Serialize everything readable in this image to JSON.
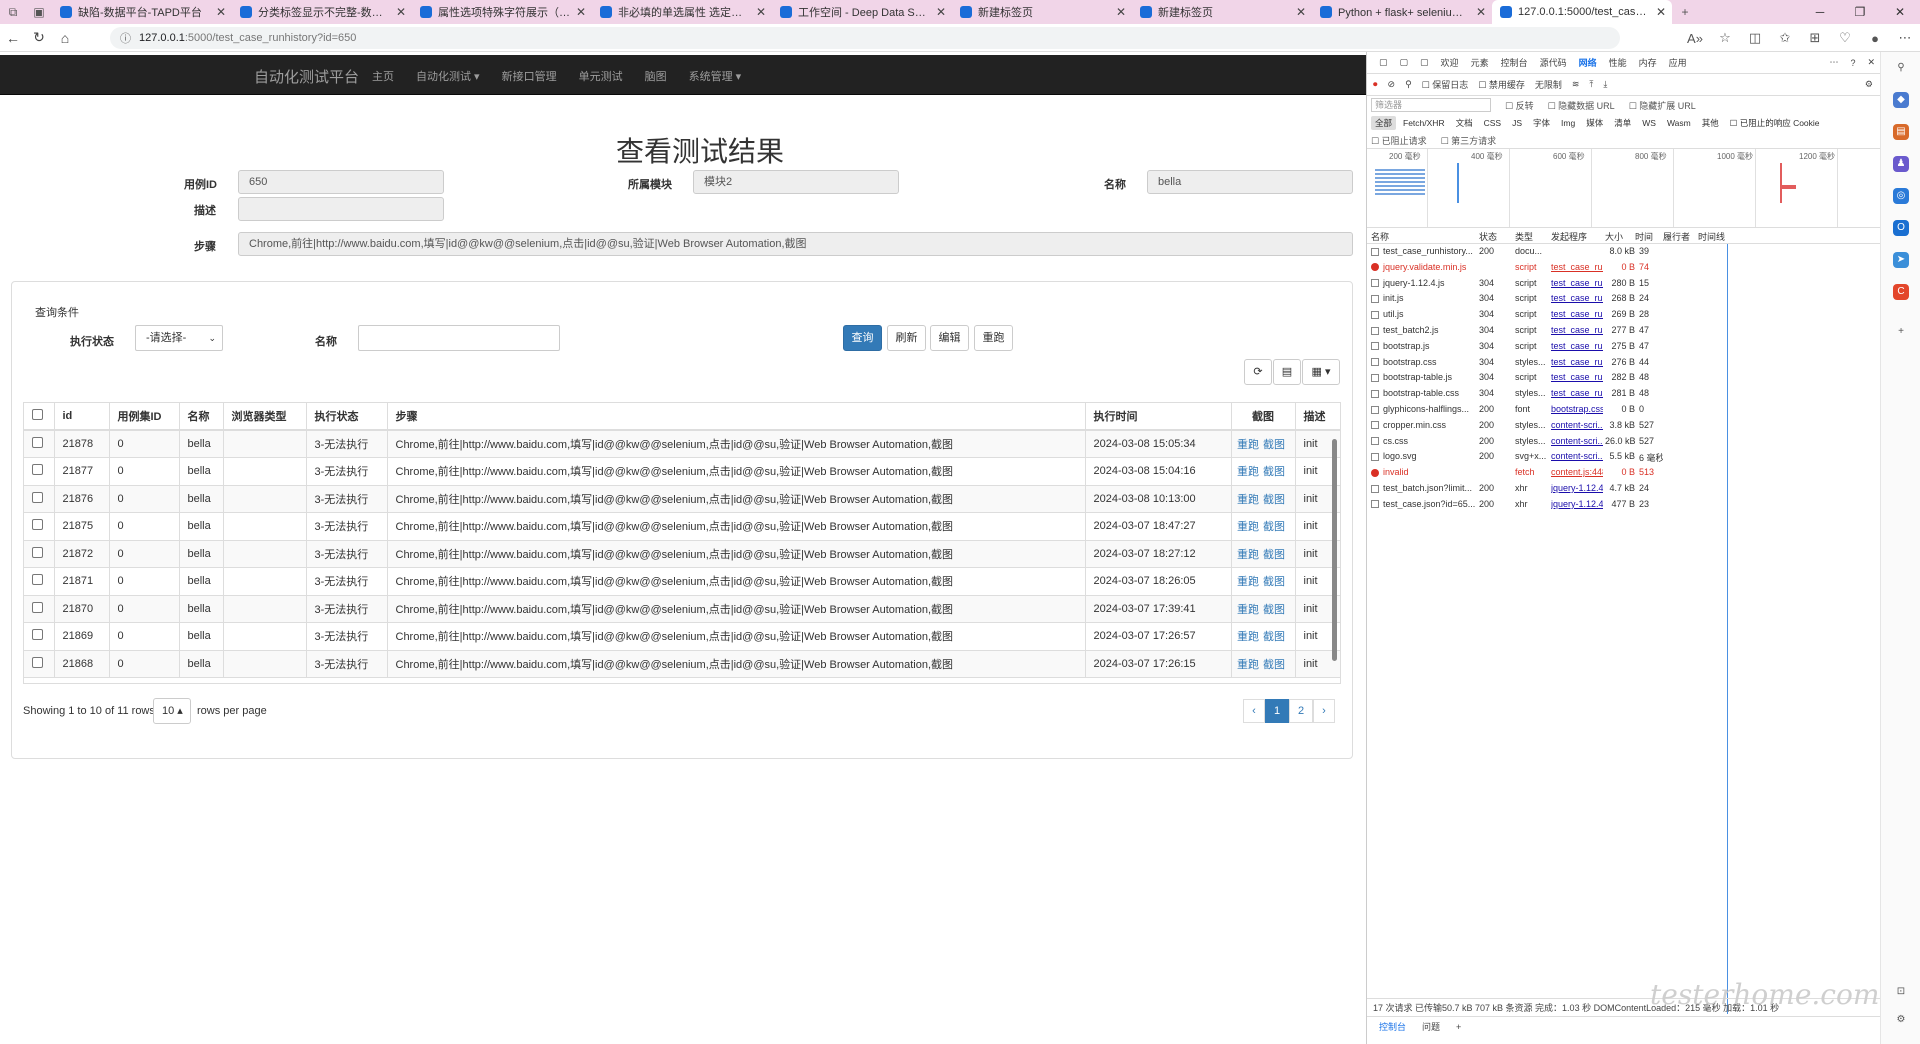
{
  "browser": {
    "tabs": [
      {
        "title": "缺陷-数据平台-TAPD平台"
      },
      {
        "title": "分类标签显示不完整-数据平台-T"
      },
      {
        "title": "属性选项特殊字符展示（空格、"
      },
      {
        "title": "非必填的单选属性 选定默认值后"
      },
      {
        "title": "工作空间 - Deep Data Space"
      },
      {
        "title": "新建标签页"
      },
      {
        "title": "新建标签页"
      },
      {
        "title": "Python + flask+ selenium 自动化"
      },
      {
        "title": "127.0.0.1:5000/test_case_runhist"
      }
    ],
    "url_host": "127.0.0.1",
    "url_path": ":5000/test_case_runhistory?id=650"
  },
  "navbar": {
    "brand": "自动化测试平台",
    "links": [
      "主页",
      "自动化测试 ▾",
      "新接口管理",
      "单元测试",
      "脑图",
      "系统管理 ▾"
    ]
  },
  "page": {
    "title": "查看测试结果",
    "case_id_label": "用例ID",
    "case_id": "650",
    "module_label": "所属模块",
    "module": "模块2",
    "name_label": "名称",
    "name": "bella",
    "desc_label": "描述",
    "desc": "",
    "steps_label": "步骤",
    "steps": "Chrome,前往|http://www.baidu.com,填写|id@@kw@@selenium,点击|id@@su,验证|Web Browser Automation,截图"
  },
  "query": {
    "title": "查询条件",
    "status_label": "执行状态",
    "status_value": "-请选择-",
    "name_label": "名称",
    "name_value": "",
    "buttons": {
      "query": "查询",
      "refresh": "刷新",
      "edit": "编辑",
      "rerun": "重跑"
    }
  },
  "table": {
    "columns": [
      "id",
      "用例集ID",
      "名称",
      "浏览器类型",
      "执行状态",
      "步骤",
      "执行时间",
      "截图",
      "描述"
    ],
    "rows": [
      {
        "id": "21878",
        "suite": "0",
        "name": "bella",
        "browser": "",
        "status": "3-无法执行",
        "steps": "Chrome,前往|http://www.baidu.com,填写|id@@kw@@selenium,点击|id@@su,验证|Web Browser Automation,截图",
        "time": "2024-03-08 15:05:34",
        "desc": "init"
      },
      {
        "id": "21877",
        "suite": "0",
        "name": "bella",
        "browser": "",
        "status": "3-无法执行",
        "steps": "Chrome,前往|http://www.baidu.com,填写|id@@kw@@selenium,点击|id@@su,验证|Web Browser Automation,截图",
        "time": "2024-03-08 15:04:16",
        "desc": "init"
      },
      {
        "id": "21876",
        "suite": "0",
        "name": "bella",
        "browser": "",
        "status": "3-无法执行",
        "steps": "Chrome,前往|http://www.baidu.com,填写|id@@kw@@selenium,点击|id@@su,验证|Web Browser Automation,截图",
        "time": "2024-03-08 10:13:00",
        "desc": "init"
      },
      {
        "id": "21875",
        "suite": "0",
        "name": "bella",
        "browser": "",
        "status": "3-无法执行",
        "steps": "Chrome,前往|http://www.baidu.com,填写|id@@kw@@selenium,点击|id@@su,验证|Web Browser Automation,截图",
        "time": "2024-03-07 18:47:27",
        "desc": "init"
      },
      {
        "id": "21872",
        "suite": "0",
        "name": "bella",
        "browser": "",
        "status": "3-无法执行",
        "steps": "Chrome,前往|http://www.baidu.com,填写|id@@kw@@selenium,点击|id@@su,验证|Web Browser Automation,截图",
        "time": "2024-03-07 18:27:12",
        "desc": "init"
      },
      {
        "id": "21871",
        "suite": "0",
        "name": "bella",
        "browser": "",
        "status": "3-无法执行",
        "steps": "Chrome,前往|http://www.baidu.com,填写|id@@kw@@selenium,点击|id@@su,验证|Web Browser Automation,截图",
        "time": "2024-03-07 18:26:05",
        "desc": "init"
      },
      {
        "id": "21870",
        "suite": "0",
        "name": "bella",
        "browser": "",
        "status": "3-无法执行",
        "steps": "Chrome,前往|http://www.baidu.com,填写|id@@kw@@selenium,点击|id@@su,验证|Web Browser Automation,截图",
        "time": "2024-03-07 17:39:41",
        "desc": "init"
      },
      {
        "id": "21869",
        "suite": "0",
        "name": "bella",
        "browser": "",
        "status": "3-无法执行",
        "steps": "Chrome,前往|http://www.baidu.com,填写|id@@kw@@selenium,点击|id@@su,验证|Web Browser Automation,截图",
        "time": "2024-03-07 17:26:57",
        "desc": "init"
      },
      {
        "id": "21868",
        "suite": "0",
        "name": "bella",
        "browser": "",
        "status": "3-无法执行",
        "steps": "Chrome,前往|http://www.baidu.com,填写|id@@kw@@selenium,点击|id@@su,验证|Web Browser Automation,截图",
        "time": "2024-03-07 17:26:15",
        "desc": "init"
      }
    ],
    "row_actions": [
      "重跑",
      "截图"
    ],
    "pagination_text": "Showing 1 to 10 of 11 rows",
    "page_size": "10",
    "rows_per_page": "rows per page",
    "pages": [
      "‹",
      "1",
      "2",
      "›"
    ]
  },
  "devtools": {
    "panels": [
      "欢迎",
      "元素",
      "控制台",
      "源代码",
      "网络",
      "性能",
      "内存",
      "应用"
    ],
    "active_panel": "网络",
    "toolbar2": [
      "保留日志",
      "禁用缓存",
      "无限制"
    ],
    "filter_placeholder": "筛选器",
    "filter_opts": [
      "反转",
      "隐藏数据 URL",
      "隐藏扩展 URL"
    ],
    "type_filters": [
      "全部",
      "Fetch/XHR",
      "文档",
      "CSS",
      "JS",
      "字体",
      "Img",
      "媒体",
      "清单",
      "WS",
      "Wasm",
      "其他"
    ],
    "blocked_cookie": "已阻止的响应 Cookie",
    "bar5": [
      "已阻止请求",
      "第三方请求"
    ],
    "timeline_ticks": [
      "200 毫秒",
      "400 毫秒",
      "600 毫秒",
      "800 毫秒",
      "1000 毫秒",
      "1200 毫秒"
    ],
    "columns": [
      "名称",
      "状态",
      "类型",
      "发起程序",
      "大小",
      "时间",
      "履行者",
      "时间线"
    ],
    "requests": [
      {
        "name": "test_case_runhistory...",
        "status": "200",
        "type": "docu...",
        "initiator": "",
        "size": "8.0 kB",
        "time": "39",
        "err": false
      },
      {
        "name": "jquery.validate.min.js",
        "status": "",
        "type": "script",
        "initiator": "test_case_ru...",
        "size": "0 B",
        "time": "74",
        "err": true
      },
      {
        "name": "jquery-1.12.4.js",
        "status": "304",
        "type": "script",
        "initiator": "test_case_ru...",
        "size": "280 B",
        "time": "15",
        "err": false
      },
      {
        "name": "init.js",
        "status": "304",
        "type": "script",
        "initiator": "test_case_ru...",
        "size": "268 B",
        "time": "24",
        "err": false
      },
      {
        "name": "util.js",
        "status": "304",
        "type": "script",
        "initiator": "test_case_ru...",
        "size": "269 B",
        "time": "28",
        "err": false
      },
      {
        "name": "test_batch2.js",
        "status": "304",
        "type": "script",
        "initiator": "test_case_ru...",
        "size": "277 B",
        "time": "47",
        "err": false
      },
      {
        "name": "bootstrap.js",
        "status": "304",
        "type": "script",
        "initiator": "test_case_ru...",
        "size": "275 B",
        "time": "47",
        "err": false
      },
      {
        "name": "bootstrap.css",
        "status": "304",
        "type": "styles...",
        "initiator": "test_case_ru...",
        "size": "276 B",
        "time": "44",
        "err": false
      },
      {
        "name": "bootstrap-table.js",
        "status": "304",
        "type": "script",
        "initiator": "test_case_ru...",
        "size": "282 B",
        "time": "48",
        "err": false
      },
      {
        "name": "bootstrap-table.css",
        "status": "304",
        "type": "styles...",
        "initiator": "test_case_ru...",
        "size": "281 B",
        "time": "48",
        "err": false
      },
      {
        "name": "glyphicons-halflings...",
        "status": "200",
        "type": "font",
        "initiator": "bootstrap.css",
        "size": "0 B",
        "time": "0",
        "err": false
      },
      {
        "name": "cropper.min.css",
        "status": "200",
        "type": "styles...",
        "initiator": "content-scri...",
        "size": "3.8 kB",
        "time": "527",
        "err": false
      },
      {
        "name": "cs.css",
        "status": "200",
        "type": "styles...",
        "initiator": "content-scri...",
        "size": "26.0 kB",
        "time": "527",
        "err": false
      },
      {
        "name": "logo.svg",
        "status": "200",
        "type": "svg+x...",
        "initiator": "content-scri...",
        "size": "5.5 kB",
        "time": "6 毫秒",
        "err": false
      },
      {
        "name": "invalid",
        "status": "",
        "type": "fetch",
        "initiator": "content.js:448",
        "size": "0 B",
        "time": "513",
        "err": true
      },
      {
        "name": "test_batch.json?limit...",
        "status": "200",
        "type": "xhr",
        "initiator": "jquery-1.12.4...",
        "size": "4.7 kB",
        "time": "24",
        "err": false
      },
      {
        "name": "test_case.json?id=65...",
        "status": "200",
        "type": "xhr",
        "initiator": "jquery-1.12.4...",
        "size": "477 B",
        "time": "23",
        "err": false
      }
    ],
    "status_bar": "17 次请求  已传输50.7 kB  707 kB 条资源  完成：1.03 秒  DOMContentLoaded：215 毫秒  加载：1.01 秒",
    "drawer": [
      "控制台",
      "问题",
      "+"
    ]
  },
  "watermark": "testerhome.com"
}
